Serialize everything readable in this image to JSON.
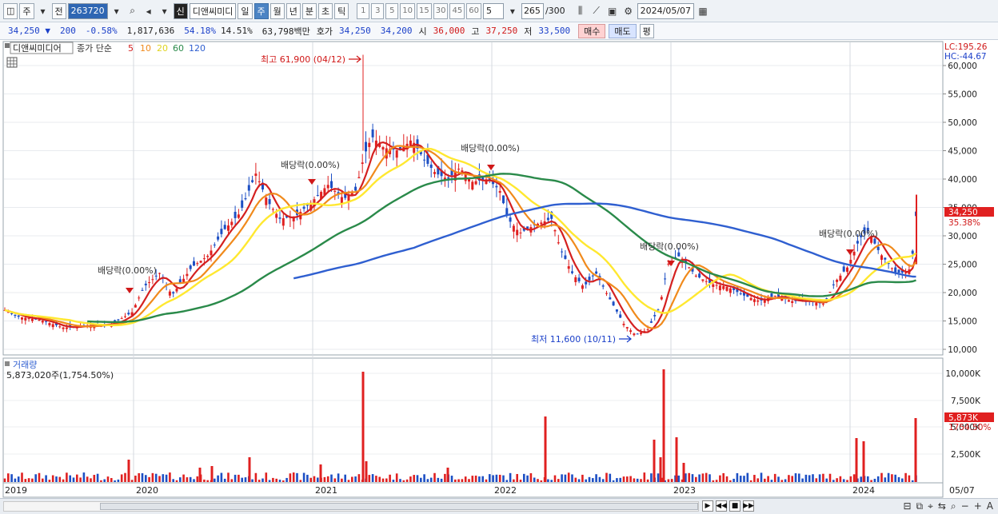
{
  "toolbar": {
    "market": "주",
    "prev_label": "전",
    "code": "263720",
    "new_badge": "신",
    "name": "디앤씨미디",
    "periods": [
      "일",
      "주",
      "월",
      "년",
      "분",
      "초",
      "틱"
    ],
    "selected_period": "주",
    "numbers": [
      "1",
      "3",
      "5",
      "10",
      "15",
      "30",
      "45",
      "60"
    ],
    "interval_value": "5",
    "count": "265",
    "count_total": "/300",
    "date": "2024/05/07"
  },
  "quote": {
    "price": "34,250",
    "change": "200",
    "change_pct": "-0.58%",
    "volume": "1,817,636",
    "ratio1": "54.18%",
    "ratio2": "14.51%",
    "amount": "63,798백만",
    "bid_label": "호가",
    "bid1": "34,250",
    "bid2": "34,200",
    "open_label": "시",
    "open": "36,000",
    "high_label": "고",
    "high": "37,250",
    "low_label": "저",
    "low": "33,500",
    "buy_label": "매수",
    "sell_label": "매도",
    "eval_label": "평"
  },
  "legend": {
    "name": "디앤씨미디어",
    "type": "종가 단순",
    "ma": [
      {
        "label": "5",
        "color": "#d42020"
      },
      {
        "label": "10",
        "color": "#f08a1c"
      },
      {
        "label": "20",
        "color": "#e8e030"
      },
      {
        "label": "60",
        "color": "#2a8a4a"
      },
      {
        "label": "120",
        "color": "#2f5fd0"
      }
    ]
  },
  "axis": {
    "lc": "LC:195.26",
    "hc": "HC:-44.67",
    "price_ticks": [
      "60,000",
      "55,000",
      "50,000",
      "45,000",
      "40,000",
      "35,000",
      "30,000",
      "25,000",
      "20,000",
      "15,000",
      "10,000"
    ],
    "current_price_tag": "34,250",
    "current_pct": "35.38%",
    "volume_ticks": [
      "10,000K",
      "7,500K",
      "5,000K",
      "2,500K"
    ],
    "volume_tag": "5,873K",
    "volume_pct": "1754.50%",
    "x_labels": [
      "2019",
      "2020",
      "2021",
      "2022",
      "2023",
      "2024",
      "05/07"
    ]
  },
  "annotations": {
    "max": "최고 61,900 (04/12)",
    "min": "최저 11,600 (10/11)",
    "dividends": [
      "배당락(0.00%)",
      "배당락(0.00%)",
      "배당락(0.00%)",
      "배당락(0.00%)",
      "배당락(0.00%)"
    ]
  },
  "volume_panel": {
    "title": "거래량",
    "value": "5,873,020주(1,754.50%)"
  },
  "chart_data": {
    "type": "line",
    "title": "디앤씨미디어",
    "series": [
      {
        "name": "5",
        "values": [
          17000,
          15200,
          13800,
          14200,
          15500,
          21000,
          23500,
          19500,
          26500,
          33000,
          41000,
          35000,
          33000,
          35000,
          39000,
          37000,
          47000,
          46000,
          45500,
          44000,
          41000,
          39000,
          40000,
          33000,
          30000,
          33000,
          25000,
          21000,
          23000,
          19000,
          14000,
          12500,
          16000,
          25000,
          26000,
          22000,
          21000,
          19500,
          18500,
          18500,
          17500,
          24000,
          29500,
          24500,
          23000,
          26000
        ]
      },
      {
        "name": "120",
        "values": [
          20500,
          23500,
          27500,
          31000,
          35000,
          35000,
          33500,
          32000,
          29500,
          27500,
          24500,
          22500
        ]
      }
    ],
    "ylim": [
      10000,
      62000
    ]
  }
}
